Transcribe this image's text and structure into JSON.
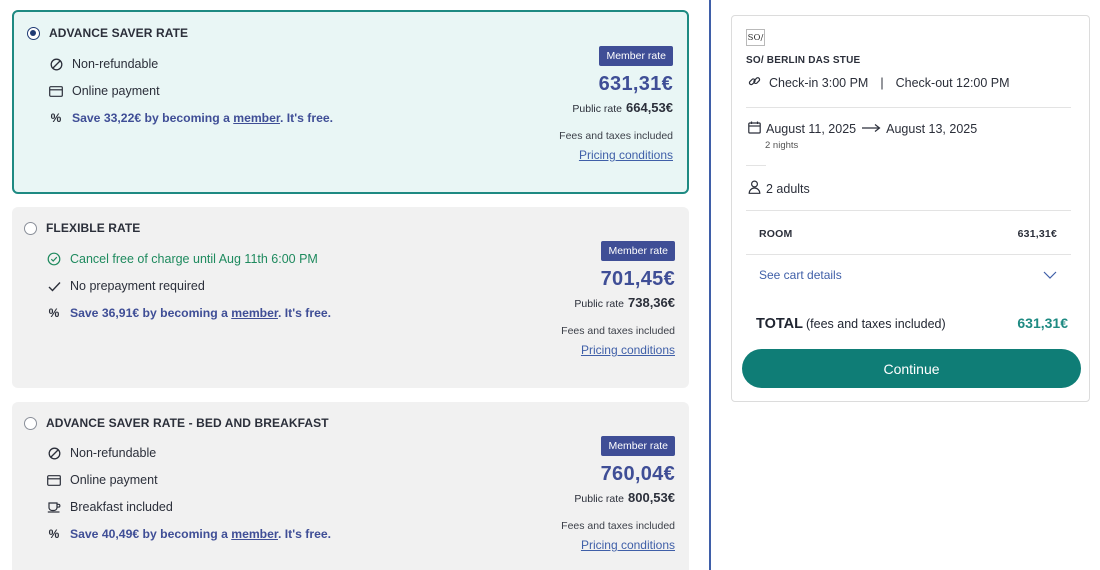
{
  "rates": [
    {
      "title": "ADVANCE SAVER RATE",
      "selected": true,
      "features": [
        {
          "icon": "no-entry-icon",
          "text": "Non-refundable"
        },
        {
          "icon": "credit-card-icon",
          "text": "Online payment"
        }
      ],
      "save": {
        "prefix": "Save 33,22€ by becoming a ",
        "link": "member",
        "suffix": ". It's free."
      },
      "badge": "Member rate",
      "member_price": "631,31€",
      "public_label": "Public rate",
      "public_price": "664,53€",
      "fees": "Fees and taxes included",
      "pricing_link": "Pricing conditions"
    },
    {
      "title": "FLEXIBLE RATE",
      "selected": false,
      "features": [
        {
          "icon": "check-circle-icon",
          "text": "Cancel free of charge until Aug 11th 6:00 PM"
        },
        {
          "icon": "checkmark-icon",
          "text": "No prepayment required"
        }
      ],
      "save": {
        "prefix": "Save 36,91€ by becoming a ",
        "link": "member",
        "suffix": ". It's free."
      },
      "badge": "Member rate",
      "member_price": "701,45€",
      "public_label": "Public rate",
      "public_price": "738,36€",
      "fees": "Fees and taxes included",
      "pricing_link": "Pricing conditions"
    },
    {
      "title": "ADVANCE SAVER RATE - BED AND BREAKFAST",
      "selected": false,
      "features": [
        {
          "icon": "no-entry-icon",
          "text": "Non-refundable"
        },
        {
          "icon": "credit-card-icon",
          "text": "Online payment"
        },
        {
          "icon": "coffee-cup-icon",
          "text": "Breakfast included"
        }
      ],
      "save": {
        "prefix": "Save 40,49€ by becoming a ",
        "link": "member",
        "suffix": ". It's free."
      },
      "badge": "Member rate",
      "member_price": "760,04€",
      "public_label": "Public rate",
      "public_price": "800,53€",
      "fees": "Fees and taxes included",
      "pricing_link": "Pricing conditions"
    }
  ],
  "summary": {
    "logo": "SO/",
    "hotel_name": "SO/ BERLIN DAS STUE",
    "checkin": "Check-in 3:00 PM",
    "separator": "|",
    "checkout": "Check-out 12:00 PM",
    "date_from": "August 11, 2025",
    "date_to": "August 13, 2025",
    "nights": "2 nights",
    "guests": "2 adults",
    "room_label": "ROOM",
    "room_price": "631,31€",
    "cart_details": "See cart details",
    "total_label": "TOTAL",
    "total_note": "(fees and taxes included)",
    "total_value": "631,31€",
    "continue_label": "Continue"
  },
  "colors": {
    "accent_teal": "#0f7d76",
    "member_blue": "#3f4e96",
    "selected_bg": "#e9f6f5"
  }
}
